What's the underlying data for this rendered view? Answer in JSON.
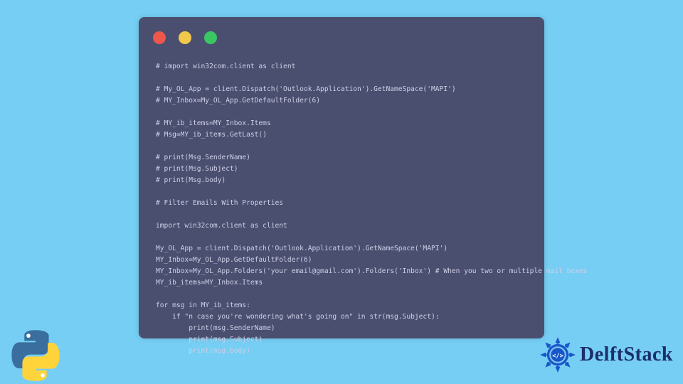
{
  "code": {
    "lines": [
      "# import win32com.client as client",
      "",
      "# My_OL_App = client.Dispatch('Outlook.Application').GetNameSpace('MAPI')",
      "# MY_Inbox=My_OL_App.GetDefaultFolder(6)",
      "",
      "# MY_ib_items=MY_Inbox.Items",
      "# Msg=MY_ib_items.GetLast()",
      "",
      "# print(Msg.SenderName)",
      "# print(Msg.Subject)",
      "# print(Msg.body)",
      "",
      "# Filter Emails With Properties",
      "",
      "import win32com.client as client",
      "",
      "My_OL_App = client.Dispatch('Outlook.Application').GetNameSpace('MAPI')",
      "MY_Inbox=My_OL_App.GetDefaultFolder(6)",
      "MY_Inbox=My_OL_App.Folders('your email@gmail.com').Folders('Inbox') # When you two or multiple mail boxes",
      "MY_ib_items=MY_Inbox.Items",
      "",
      "for msg in MY_ib_items:",
      "    if \"n case you're wondering what's going on\" in str(msg.Subject):",
      "        print(msg.SenderName)",
      "        print(msg.Subject)",
      "        print(msg.body)"
    ]
  },
  "brand": {
    "site": "DelftStack"
  },
  "colors": {
    "page_bg": "#76cef4",
    "card_bg": "#4a4f70",
    "code_fg": "#cfcfe6",
    "dot_red": "#ed574c",
    "dot_yellow": "#f2c84b",
    "dot_green": "#3ac663",
    "brand_text": "#1b2f6b",
    "rosette": "#1757c9",
    "py_blue": "#396e9e",
    "py_yellow": "#ffd43b"
  }
}
